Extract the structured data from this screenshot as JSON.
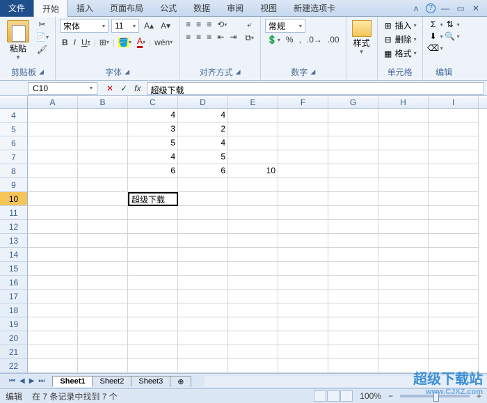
{
  "tabs": {
    "file": "文件",
    "home": "开始",
    "insert": "插入",
    "layout": "页面布局",
    "formulas": "公式",
    "data": "数据",
    "review": "审阅",
    "view": "视图",
    "addin": "新建选项卡"
  },
  "ribbon": {
    "clipboard": {
      "paste": "粘贴",
      "label": "剪贴板"
    },
    "font": {
      "name": "宋体",
      "size": "11",
      "label": "字体"
    },
    "align": {
      "label": "对齐方式"
    },
    "number": {
      "format": "常规",
      "label": "数字"
    },
    "styles": {
      "label": "样式"
    },
    "cells": {
      "insert": "插入",
      "delete": "删除",
      "format": "格式",
      "label": "单元格"
    },
    "editing": {
      "label": "编辑"
    }
  },
  "namebox": "C10",
  "formula_value": "超级下载",
  "columns": [
    "A",
    "B",
    "C",
    "D",
    "E",
    "F",
    "G",
    "H",
    "I"
  ],
  "rows": [
    4,
    5,
    6,
    7,
    8,
    9,
    10,
    11,
    12,
    13,
    14,
    15,
    16,
    17,
    18,
    19,
    20,
    21,
    22
  ],
  "active_row": 10,
  "cells": {
    "r4": {
      "C": "4",
      "D": "4"
    },
    "r5": {
      "C": "3",
      "D": "2"
    },
    "r6": {
      "C": "5",
      "D": "4"
    },
    "r7": {
      "C": "4",
      "D": "5"
    },
    "r8": {
      "C": "6",
      "D": "6",
      "E": "10"
    },
    "r10": {
      "C": "超级下载"
    }
  },
  "sheets": {
    "nav": [
      "⏮",
      "◀",
      "▶",
      "⏭"
    ],
    "s1": "Sheet1",
    "s2": "Sheet2",
    "s3": "Sheet3"
  },
  "status": {
    "mode": "编辑",
    "msg": "在 7 条记录中找到 7 个",
    "zoom": "100%"
  },
  "watermark": {
    "line1": "超级下载站",
    "line2": "www.CJXZ.com"
  }
}
